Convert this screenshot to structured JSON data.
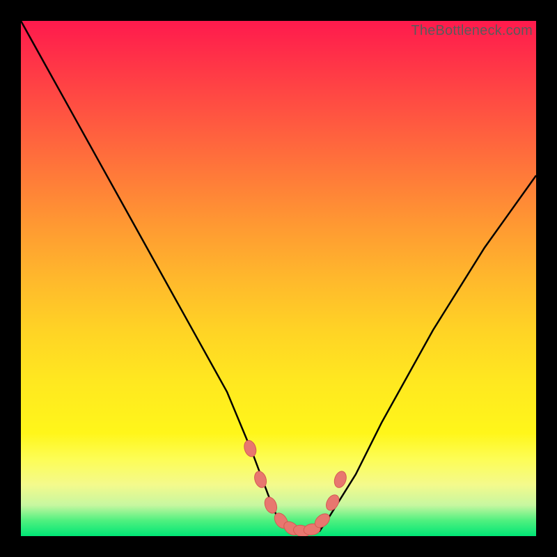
{
  "watermark": "TheBottleneck.com",
  "chart_data": {
    "type": "line",
    "title": "",
    "xlabel": "",
    "ylabel": "",
    "xlim": [
      0,
      100
    ],
    "ylim": [
      0,
      100
    ],
    "curve": {
      "name": "bottleneck-curve",
      "x": [
        0,
        5,
        10,
        15,
        20,
        25,
        30,
        35,
        40,
        45,
        48,
        50,
        52,
        54,
        56,
        58,
        60,
        65,
        70,
        75,
        80,
        85,
        90,
        95,
        100
      ],
      "y": [
        100,
        91,
        82,
        73,
        64,
        55,
        46,
        37,
        28,
        16,
        8,
        3,
        1,
        0.5,
        0.5,
        1,
        4,
        12,
        22,
        31,
        40,
        48,
        56,
        63,
        70
      ]
    },
    "markers": {
      "name": "optimal-points",
      "x": [
        44.5,
        46.5,
        48.5,
        50.5,
        52.5,
        54.5,
        56.5,
        58.5,
        60.5,
        62.0
      ],
      "y": [
        17,
        11,
        6,
        3,
        1.5,
        1.0,
        1.3,
        3,
        6.5,
        11
      ]
    }
  }
}
